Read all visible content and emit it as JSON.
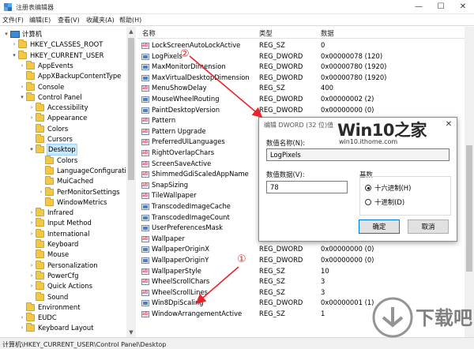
{
  "window": {
    "title": "注册表编辑器"
  },
  "window_controls": {
    "minimize": "—",
    "maximize": "☐",
    "close": "✕"
  },
  "menu": [
    "文件(F)",
    "编辑(E)",
    "查看(V)",
    "收藏夹(A)",
    "帮助(H)"
  ],
  "tree": [
    {
      "label": "计算机",
      "level": 0,
      "exp": "▾",
      "kind": "pc"
    },
    {
      "label": "HKEY_CLASSES_ROOT",
      "level": 1,
      "exp": "›",
      "kind": "folder"
    },
    {
      "label": "HKEY_CURRENT_USER",
      "level": 1,
      "exp": "▾",
      "kind": "folder"
    },
    {
      "label": "AppEvents",
      "level": 2,
      "exp": "›",
      "kind": "folder"
    },
    {
      "label": "AppXBackupContentType",
      "level": 2,
      "exp": "",
      "kind": "folder"
    },
    {
      "label": "Console",
      "level": 2,
      "exp": "›",
      "kind": "folder"
    },
    {
      "label": "Control Panel",
      "level": 2,
      "exp": "▾",
      "kind": "folder"
    },
    {
      "label": "Accessibility",
      "level": 3,
      "exp": "›",
      "kind": "folder"
    },
    {
      "label": "Appearance",
      "level": 3,
      "exp": "›",
      "kind": "folder"
    },
    {
      "label": "Colors",
      "level": 3,
      "exp": "",
      "kind": "folder"
    },
    {
      "label": "Cursors",
      "level": 3,
      "exp": "",
      "kind": "folder"
    },
    {
      "label": "Desktop",
      "level": 3,
      "exp": "▾",
      "kind": "folder",
      "selected": true
    },
    {
      "label": "Colors",
      "level": 4,
      "exp": "",
      "kind": "folder"
    },
    {
      "label": "LanguageConfiguratio",
      "level": 4,
      "exp": "",
      "kind": "folder"
    },
    {
      "label": "MuiCached",
      "level": 4,
      "exp": "",
      "kind": "folder"
    },
    {
      "label": "PerMonitorSettings",
      "level": 4,
      "exp": "›",
      "kind": "folder"
    },
    {
      "label": "WindowMetrics",
      "level": 4,
      "exp": "",
      "kind": "folder"
    },
    {
      "label": "Infrared",
      "level": 3,
      "exp": "›",
      "kind": "folder"
    },
    {
      "label": "Input Method",
      "level": 3,
      "exp": "›",
      "kind": "folder"
    },
    {
      "label": "International",
      "level": 3,
      "exp": "›",
      "kind": "folder"
    },
    {
      "label": "Keyboard",
      "level": 3,
      "exp": "",
      "kind": "folder"
    },
    {
      "label": "Mouse",
      "level": 3,
      "exp": "",
      "kind": "folder"
    },
    {
      "label": "Personalization",
      "level": 3,
      "exp": "›",
      "kind": "folder"
    },
    {
      "label": "PowerCfg",
      "level": 3,
      "exp": "›",
      "kind": "folder"
    },
    {
      "label": "Quick Actions",
      "level": 3,
      "exp": "›",
      "kind": "folder"
    },
    {
      "label": "Sound",
      "level": 3,
      "exp": "",
      "kind": "folder"
    },
    {
      "label": "Environment",
      "level": 2,
      "exp": "",
      "kind": "folder"
    },
    {
      "label": "EUDC",
      "level": 2,
      "exp": "›",
      "kind": "folder"
    },
    {
      "label": "Keyboard Layout",
      "level": 2,
      "exp": "›",
      "kind": "folder"
    }
  ],
  "list": {
    "columns": [
      "名称",
      "类型",
      "数据"
    ],
    "rows": [
      {
        "name": "LockScreenAutoLockActive",
        "type": "REG_SZ",
        "data": "0",
        "icon": "sz"
      },
      {
        "name": "LogPixels",
        "type": "REG_DWORD",
        "data": "0x00000078 (120)",
        "icon": "dw"
      },
      {
        "name": "MaxMonitorDimension",
        "type": "REG_DWORD",
        "data": "0x00000780 (1920)",
        "icon": "dw"
      },
      {
        "name": "MaxVirtualDesktopDimension",
        "type": "REG_DWORD",
        "data": "0x00000780 (1920)",
        "icon": "dw"
      },
      {
        "name": "MenuShowDelay",
        "type": "REG_SZ",
        "data": "400",
        "icon": "sz"
      },
      {
        "name": "MouseWheelRouting",
        "type": "REG_DWORD",
        "data": "0x00000002 (2)",
        "icon": "dw"
      },
      {
        "name": "PaintDesktopVersion",
        "type": "REG_DWORD",
        "data": "0x00000000 (0)",
        "icon": "dw"
      },
      {
        "name": "Pattern",
        "type": "",
        "data": "",
        "icon": "sz"
      },
      {
        "name": "Pattern Upgrade",
        "type": "",
        "data": "",
        "icon": "sz"
      },
      {
        "name": "PreferredUILanguages",
        "type": "",
        "data": "",
        "icon": "sz"
      },
      {
        "name": "RightOverlapChars",
        "type": "",
        "data": "",
        "icon": "sz"
      },
      {
        "name": "ScreenSaveActive",
        "type": "",
        "data": "",
        "icon": "sz"
      },
      {
        "name": "ShimmedGdiScaledAppName",
        "type": "",
        "data": "",
        "icon": "sz"
      },
      {
        "name": "SnapSizing",
        "type": "",
        "data": "",
        "icon": "sz"
      },
      {
        "name": "TileWallpaper",
        "type": "",
        "data": "",
        "icon": "sz"
      },
      {
        "name": "TranscodedImageCache",
        "type": "",
        "data": "",
        "icon": "dw"
      },
      {
        "name": "TranscodedImageCount",
        "type": "",
        "data": "",
        "icon": "dw"
      },
      {
        "name": "UserPreferencesMask",
        "type": "",
        "data": "",
        "icon": "dw"
      },
      {
        "name": "Wallpaper",
        "type": "",
        "data": "",
        "icon": "sz"
      },
      {
        "name": "WallpaperOriginX",
        "type": "REG_DWORD",
        "data": "0x00000000 (0)",
        "icon": "dw"
      },
      {
        "name": "WallpaperOriginY",
        "type": "REG_DWORD",
        "data": "0x00000000 (0)",
        "icon": "dw"
      },
      {
        "name": "WallpaperStyle",
        "type": "REG_SZ",
        "data": "10",
        "icon": "sz"
      },
      {
        "name": "WheelScrollChars",
        "type": "REG_SZ",
        "data": "3",
        "icon": "sz"
      },
      {
        "name": "WheelScrollLines",
        "type": "REG_SZ",
        "data": "3",
        "icon": "sz"
      },
      {
        "name": "Win8DpiScaling",
        "type": "REG_DWORD",
        "data": "0x00000001 (1)",
        "icon": "dw"
      },
      {
        "name": "WindowArrangementActive",
        "type": "REG_SZ",
        "data": "1",
        "icon": "sz"
      }
    ]
  },
  "status": "计算机\\HKEY_CURRENT_USER\\Control Panel\\Desktop",
  "dialog": {
    "title": "编辑 DWORD (32 位)值",
    "close": "✕",
    "name_label": "数值名称(N):",
    "name_value": "LogPixels",
    "data_label": "数值数据(V):",
    "data_value": "78",
    "base_label": "基数",
    "hex_label": "十六进制(H)",
    "dec_label": "十进制(D)",
    "ok_label": "确定",
    "cancel_label": "取消"
  },
  "watermark": {
    "brand": "Win10之家",
    "url": "win10.ithome.com",
    "logo_text": "下载吧"
  },
  "annotations": {
    "marker1": "①",
    "marker2": "②"
  },
  "colors": {
    "selection": "#cce8ff",
    "accent": "#0078d7",
    "arrow": "#e8242b",
    "folder": "#f3c846"
  }
}
